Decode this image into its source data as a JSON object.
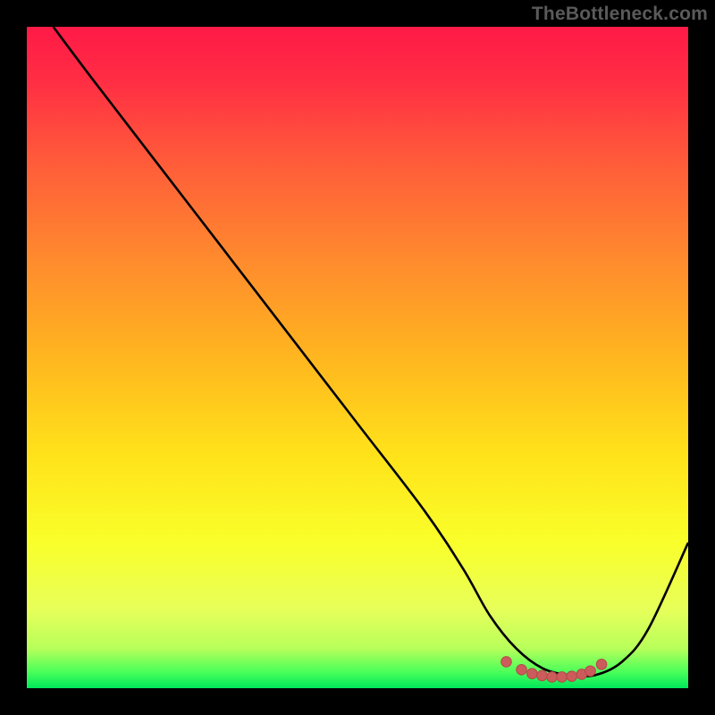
{
  "watermark": "TheBottleneck.com",
  "chart_data": {
    "type": "line",
    "title": "",
    "xlabel": "",
    "ylabel": "",
    "xlim": [
      0,
      100
    ],
    "ylim": [
      0,
      100
    ],
    "grid": false,
    "legend": false,
    "series": [
      {
        "name": "bottleneck-curve",
        "x": [
          4,
          10,
          20,
          30,
          40,
          50,
          60,
          66,
          70,
          74,
          78,
          82,
          86,
          90,
          94,
          100
        ],
        "y": [
          100,
          92,
          79,
          66,
          53,
          40,
          27,
          18,
          11,
          6,
          3,
          2,
          2,
          4,
          9,
          22
        ]
      }
    ],
    "highlight_region": {
      "name": "optimal-range-dots",
      "x": [
        72.5,
        74.8,
        76.4,
        77.9,
        79.4,
        80.9,
        82.4,
        83.9,
        85.2,
        86.9
      ],
      "y": [
        4.0,
        2.8,
        2.2,
        1.9,
        1.7,
        1.7,
        1.8,
        2.1,
        2.6,
        3.6
      ]
    },
    "background_gradient": {
      "stops": [
        {
          "offset": 0.0,
          "color": "#ff1a47"
        },
        {
          "offset": 0.08,
          "color": "#ff2d44"
        },
        {
          "offset": 0.2,
          "color": "#ff5a3a"
        },
        {
          "offset": 0.35,
          "color": "#ff8a2e"
        },
        {
          "offset": 0.5,
          "color": "#ffb61f"
        },
        {
          "offset": 0.65,
          "color": "#ffe31a"
        },
        {
          "offset": 0.78,
          "color": "#f9ff2a"
        },
        {
          "offset": 0.88,
          "color": "#e8ff5a"
        },
        {
          "offset": 0.94,
          "color": "#b8ff5a"
        },
        {
          "offset": 0.975,
          "color": "#4bff5a"
        },
        {
          "offset": 1.0,
          "color": "#00e85a"
        }
      ]
    },
    "colors": {
      "curve": "#000000",
      "dots": "#cc5b5b",
      "dot_stroke": "#b54848"
    }
  }
}
